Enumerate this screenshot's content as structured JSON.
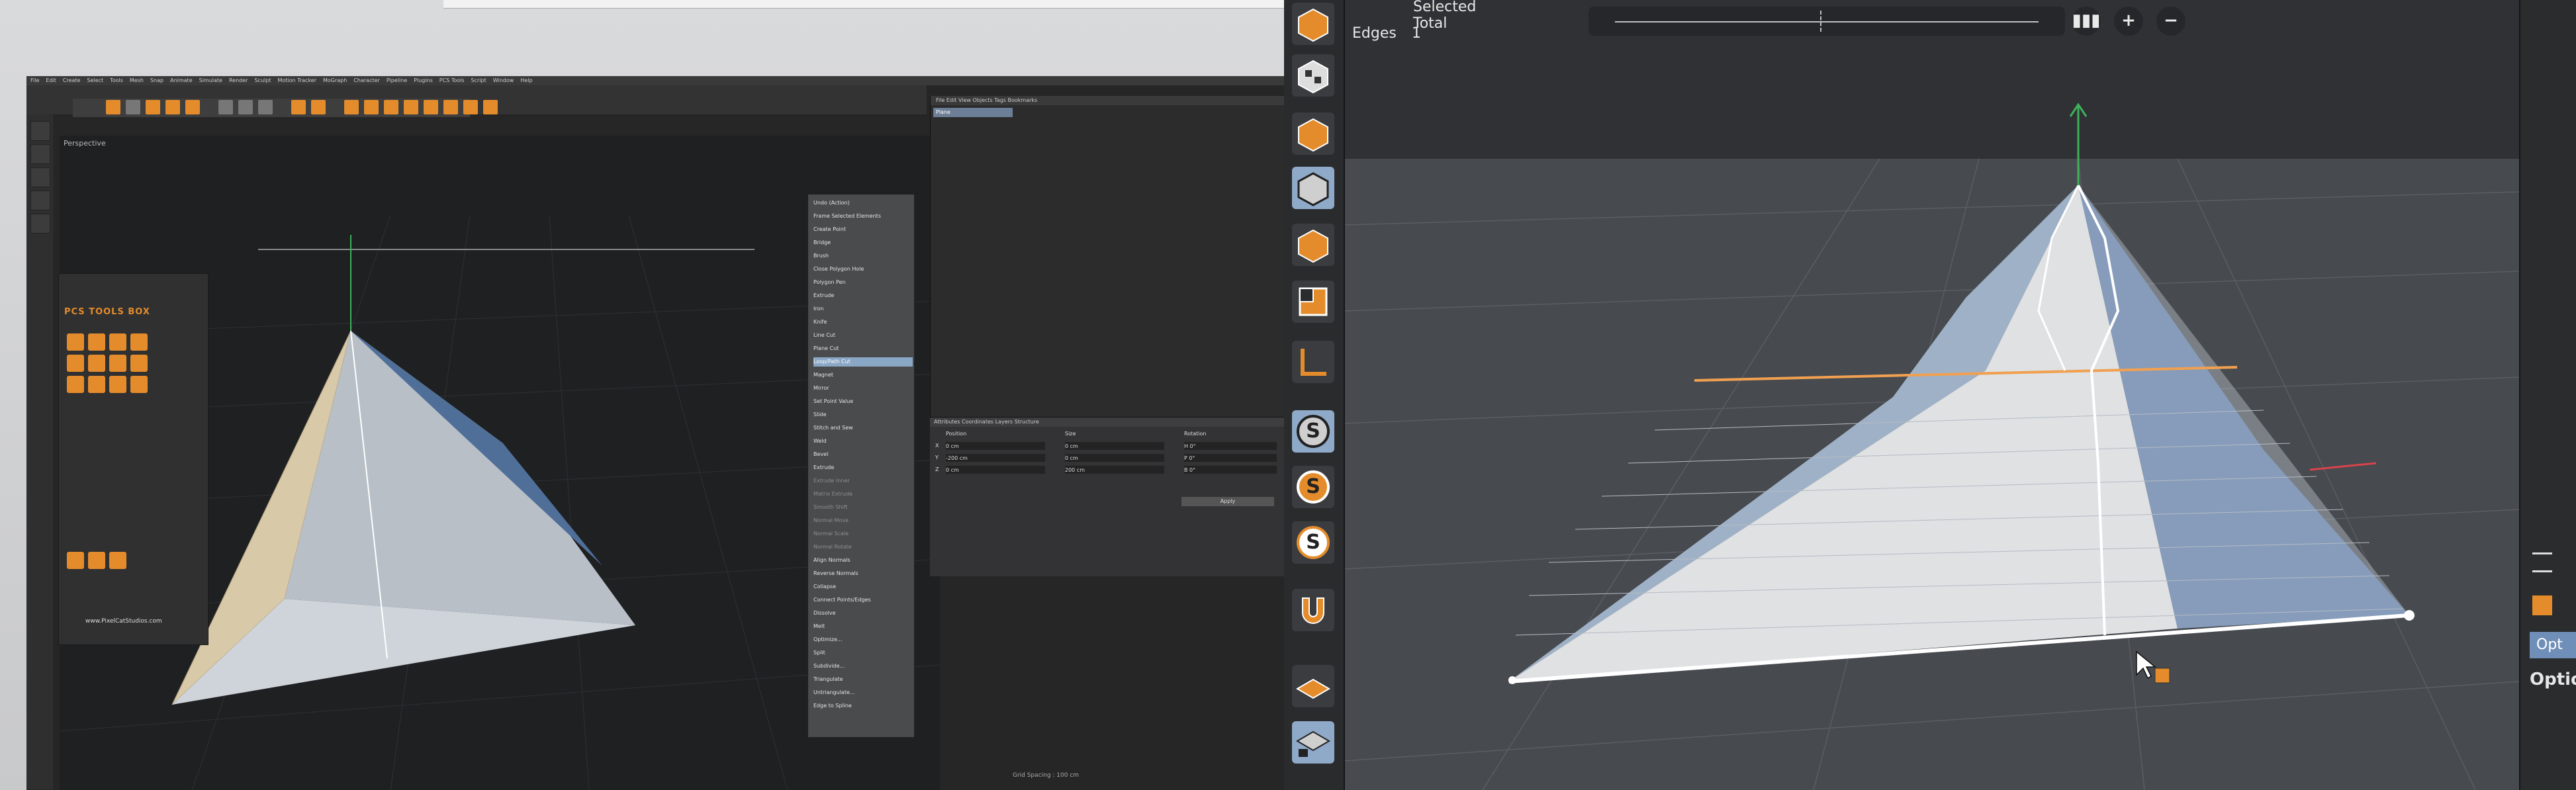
{
  "left_monitor": {
    "menu": [
      "File",
      "Edit",
      "Create",
      "Select",
      "Tools",
      "Mesh",
      "Snap",
      "Animate",
      "Simulate",
      "Render",
      "Sculpt",
      "Motion Tracker",
      "MoGraph",
      "Character",
      "Pipeline",
      "Plugins",
      "PCS Tools",
      "Script",
      "Window",
      "Help"
    ],
    "viewport_label": "Perspective",
    "pcs_title": "PCS TOOLS BOX",
    "pcs_link": "www.PixelCatStudios.com",
    "context_menu": [
      {
        "label": "Undo (Action)",
        "state": "normal"
      },
      {
        "label": "Frame Selected Elements",
        "state": "normal"
      },
      {
        "label": "Create Point",
        "state": "normal"
      },
      {
        "label": "Bridge",
        "state": "normal"
      },
      {
        "label": "Brush",
        "state": "normal"
      },
      {
        "label": "Close Polygon Hole",
        "state": "normal"
      },
      {
        "label": "Polygon Pen",
        "state": "normal"
      },
      {
        "label": "Extrude",
        "state": "normal"
      },
      {
        "label": "Iron",
        "state": "normal"
      },
      {
        "label": "Knife",
        "state": "normal"
      },
      {
        "label": "Line Cut",
        "state": "normal"
      },
      {
        "label": "Plane Cut",
        "state": "normal"
      },
      {
        "label": "Loop/Path Cut",
        "state": "highlight"
      },
      {
        "label": "Magnet",
        "state": "normal"
      },
      {
        "label": "Mirror",
        "state": "normal"
      },
      {
        "label": "Set Point Value",
        "state": "normal"
      },
      {
        "label": "Slide",
        "state": "normal"
      },
      {
        "label": "Stitch and Sew",
        "state": "normal"
      },
      {
        "label": "Weld",
        "state": "normal"
      },
      {
        "label": "Bevel",
        "state": "normal"
      },
      {
        "label": "Extrude",
        "state": "normal"
      },
      {
        "label": "Extrude Inner",
        "state": "dim"
      },
      {
        "label": "Matrix Extrude",
        "state": "dim"
      },
      {
        "label": "Smooth Shift",
        "state": "dim"
      },
      {
        "label": "Normal Move",
        "state": "dim"
      },
      {
        "label": "Normal Scale",
        "state": "dim"
      },
      {
        "label": "Normal Rotate",
        "state": "dim"
      },
      {
        "label": "Align Normals",
        "state": "normal"
      },
      {
        "label": "Reverse Normals",
        "state": "normal"
      },
      {
        "label": "Collapse",
        "state": "normal"
      },
      {
        "label": "Connect Points/Edges",
        "state": "normal"
      },
      {
        "label": "Dissolve",
        "state": "normal"
      },
      {
        "label": "Melt",
        "state": "normal"
      },
      {
        "label": "Optimize...",
        "state": "normal"
      },
      {
        "label": "Split",
        "state": "normal"
      },
      {
        "label": "Subdivide...",
        "state": "normal"
      },
      {
        "label": "Triangulate",
        "state": "normal"
      },
      {
        "label": "Untriangulate...",
        "state": "normal"
      },
      {
        "label": "Edge to Spline",
        "state": "normal"
      }
    ],
    "object_manager_tabs": "File  Edit  View  Objects  Tags  Bookmarks",
    "object_name": "Plane",
    "coord_tabs": "Attributes  Coordinates  Layers  Structure",
    "coord_headers": [
      "Position",
      "Size",
      "Rotation"
    ],
    "coord_rows": [
      {
        "axis": "X",
        "pos": "0 cm",
        "size": "0 cm",
        "rot": "H 0°"
      },
      {
        "axis": "Y",
        "pos": "-200 cm",
        "size": "0 cm",
        "rot": "P 0°"
      },
      {
        "axis": "Z",
        "pos": "0 cm",
        "size": "200 cm",
        "rot": "B 0°"
      }
    ],
    "coord_apply": "Apply",
    "grid_status": "Grid Spacing : 100 cm"
  },
  "right_viewport": {
    "hud_title": "Selected Total",
    "hud_label": "Edges",
    "hud_value": "1",
    "attr_tab": "Opt",
    "attr_section": "Optio"
  },
  "colors": {
    "accent_orange": "#e48c2b",
    "selection_blue": "#8fa9c8",
    "axis_green": "#3fb15a",
    "axis_red": "#d8434b"
  }
}
